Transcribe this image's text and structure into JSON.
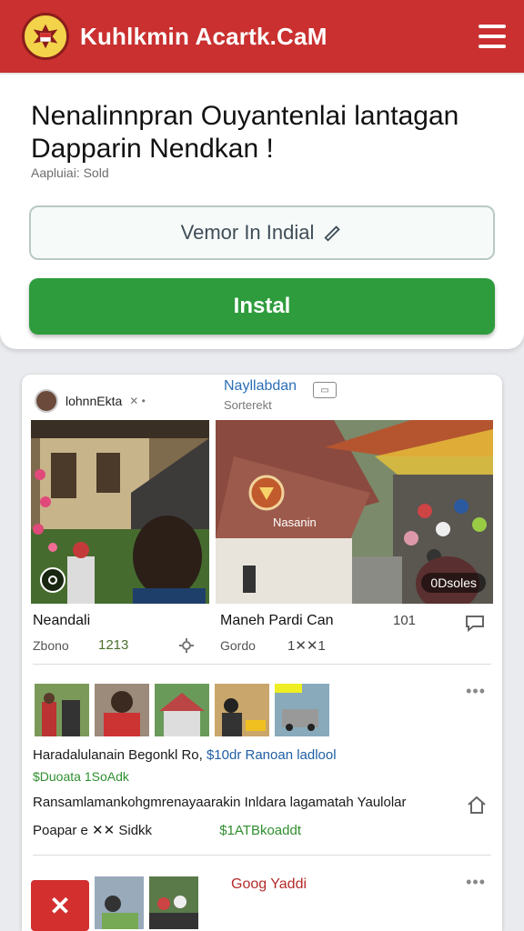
{
  "header": {
    "app_title": "Kuhlkmin Acartk.CaM",
    "logo_icon": "garuda-emblem-icon",
    "menu_icon": "hamburger-menu-icon"
  },
  "install": {
    "title": "Nenalinnpran Ouyantenlai lantagan Dapparin Nendkan !",
    "subtitle": "Aapluiai: Sold",
    "verify_label": "Vemor In Indial",
    "install_label": "Instal"
  },
  "post": {
    "author": "lohnnEkta",
    "author_extra": "✕ •",
    "nav_label": "Nayllabdan",
    "nav_sub": "Sorterekt",
    "photo_b_label": "Nasanin",
    "photo_b_views": "0Dsoles",
    "caption_left": "Neandali",
    "caption_right": "Maneh Pardi Can",
    "caption_num": "101",
    "meta_left": "Zbono",
    "meta_left_num": "1213",
    "meta_right": "Gordo",
    "meta_right_num": "1✕✕1"
  },
  "listing1": {
    "title_a": "Haradalulanain Begonkl Ro,",
    "title_b": "$10dr Ranoan ladlool",
    "price": "$Duoata 1SoAdk",
    "desc": "Ransamlamankohgmrenayaarakin Inldara lagamatah Yaulolar",
    "footer_a": "Poapar e ✕✕ Sidkk",
    "footer_b": "$1ATBkoaddt",
    "dots": "•••"
  },
  "listing2": {
    "title": "Goog Yaddi",
    "dots": "•••",
    "close_label": "✕"
  },
  "colors": {
    "brand_red": "#c9302f",
    "install_green": "#2e9c3d",
    "link_blue": "#2a6fb7"
  }
}
